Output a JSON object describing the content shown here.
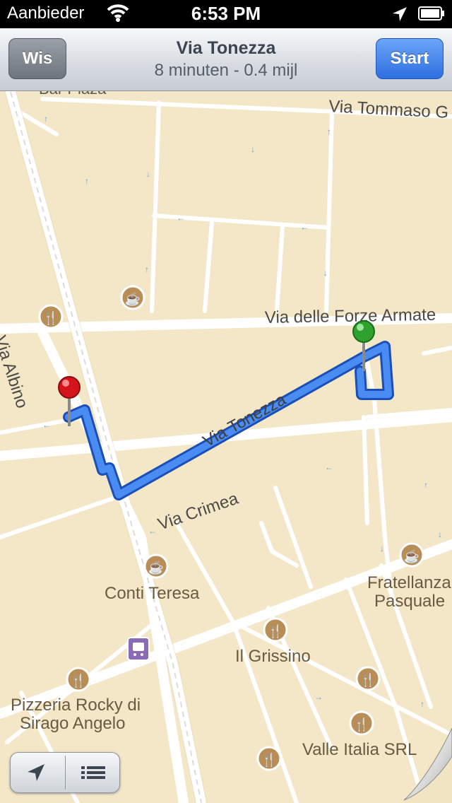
{
  "status_bar": {
    "carrier": "Aanbieder",
    "time": "6:53 PM"
  },
  "nav_bar": {
    "clear_button": "Wis",
    "start_button": "Start",
    "title": "Via Tonezza",
    "subtitle": "8 minuten - 0.4 mijl"
  },
  "map": {
    "street_labels": {
      "bar_plaza": "Bar Plaza",
      "via_tommaso": "Via Tommaso G",
      "via_forze": "Via delle Forze Armate",
      "via_albino": "Via Albino",
      "via_tonezza": "Via Tonezza",
      "via_crimea": "Via Crimea"
    },
    "pois": {
      "conti_teresa": "Conti Teresa",
      "fratellanza_1": "Fratellanza",
      "fratellanza_2": "Pasquale",
      "il_grissino": "Il Grissino",
      "pizzeria_1": "Pizzeria Rocky di",
      "pizzeria_2": "Sirago Angelo",
      "valle_italia": "Valle Italia SRL"
    }
  },
  "icons": [
    "wifi-icon",
    "location-arrow-icon",
    "battery-icon",
    "coffee-icon",
    "restaurant-icon",
    "train-station-icon",
    "list-icon",
    "page-curl-icon",
    "start-pin-icon",
    "end-pin-icon"
  ],
  "colors": {
    "route": "#2f6de2",
    "start_pin": "#2ea12e",
    "end_pin": "#d4141a",
    "map_bg": "#f3e7c8",
    "road": "#ffffff",
    "start_button": "#3b7ff0"
  }
}
